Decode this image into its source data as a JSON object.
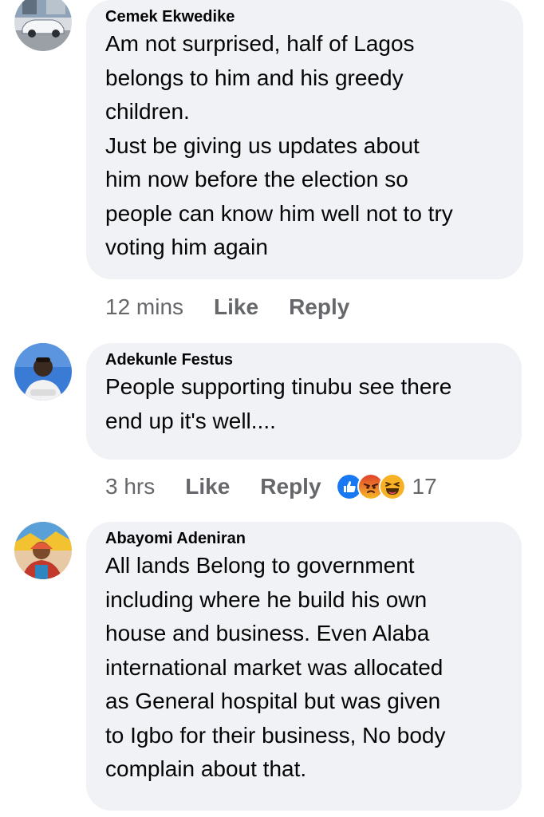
{
  "comments": [
    {
      "author": "Cemek Ekwedike",
      "text": "Am not surprised, half of Lagos\nbelongs to him and his greedy\nchildren.\nJust be giving us updates about\nhim now before the election so\npeople can know him well not to try\nvoting him again",
      "time": "12 mins",
      "like_label": "Like",
      "reply_label": "Reply"
    },
    {
      "author": "Adekunle Festus",
      "text": "People supporting tinubu see there\nend up it's well....",
      "time": "3 hrs",
      "like_label": "Like",
      "reply_label": "Reply",
      "reactions": {
        "icons": [
          "like-icon",
          "angry-icon",
          "haha-icon"
        ],
        "count": "17"
      }
    },
    {
      "author": "Abayomi Adeniran",
      "text": "All lands Belong to government\nincluding where he build his own\nhouse and business. Even Alaba\ninternational market was allocated\nas General hospital but was given\nto Igbo for their business,  No body\ncomplain about that."
    }
  ],
  "colors": {
    "bubble": "#f0f2f5",
    "author": "#050505",
    "meta": "#65676b",
    "like_reaction": "#1877f2",
    "angry_reaction": "#e9710f",
    "haha_reaction": "#f7b125"
  }
}
